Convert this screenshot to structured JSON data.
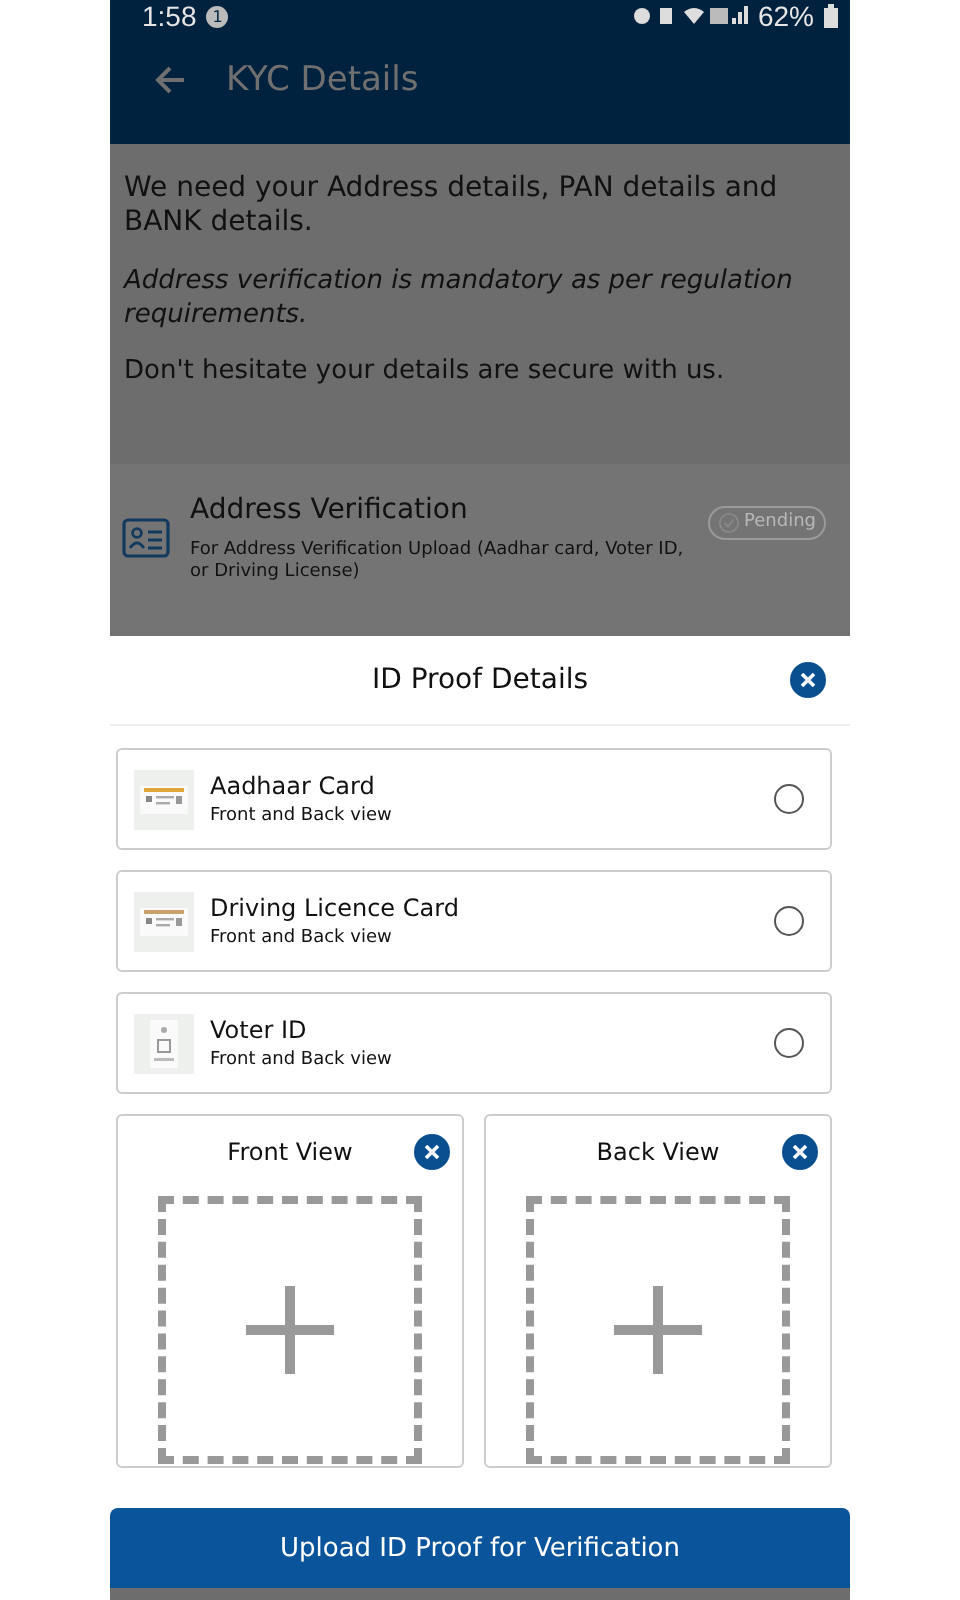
{
  "status_bar": {
    "time": "1:58",
    "notification_count": "1",
    "battery": "62%"
  },
  "app_bar": {
    "title": "KYC Details"
  },
  "intro": [
    {
      "kind": "plain",
      "text": "We need your Address details, PAN details and BANK details."
    },
    {
      "kind": "italic",
      "text": "Address verification is mandatory as per regulation requirements."
    },
    {
      "kind": "small",
      "text": "Don't hesitate your details are secure with us."
    }
  ],
  "address_verification": {
    "title": "Address Verification",
    "description": "For Address Verification Upload (Aadhar card, Voter ID, or Driving License)",
    "status": "Pending"
  },
  "sheet": {
    "title": "ID Proof Details",
    "options": [
      {
        "kind": "aadhaar",
        "title": "Aadhaar Card",
        "subtitle": "Front and Back view",
        "selected": false
      },
      {
        "kind": "licence",
        "title": "Driving Licence Card",
        "subtitle": "Front and Back view",
        "selected": false
      },
      {
        "kind": "voter",
        "title": "Voter ID",
        "subtitle": "Front and Back view",
        "selected": false
      }
    ],
    "uploads": [
      {
        "label": "Front View"
      },
      {
        "label": "Back View"
      }
    ],
    "button": "Upload ID Proof for Verification"
  }
}
